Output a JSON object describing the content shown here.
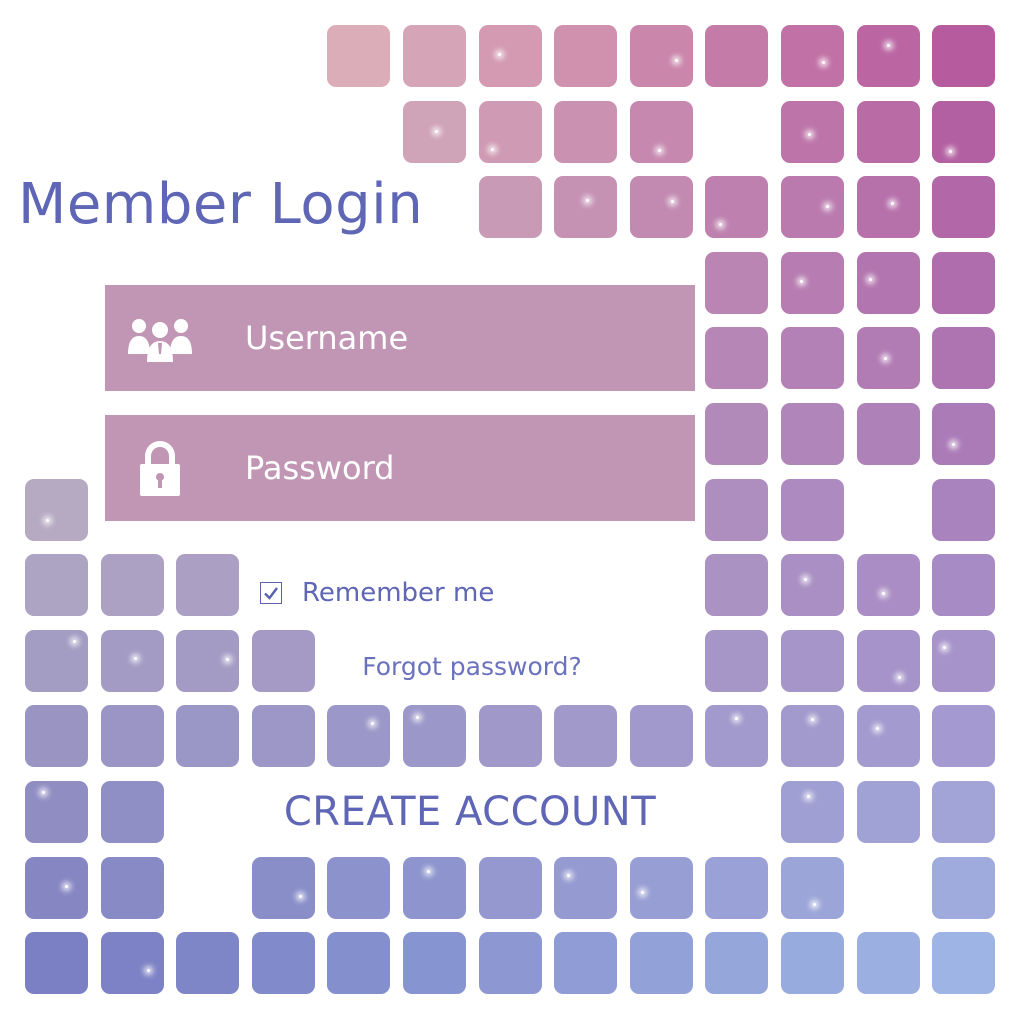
{
  "title": "Member Login",
  "username": {
    "placeholder": "Username",
    "icon": "users-icon"
  },
  "password": {
    "placeholder": "Password",
    "icon": "lock-icon"
  },
  "remember": {
    "label": "Remember me",
    "checked": true
  },
  "forgot_label": "Forgot password?",
  "create_label": "CREATE ACCOUNT",
  "colors": {
    "title": "#5e66b5",
    "field_bg": "#c195b4",
    "mosaic_top_left": "#e8c0aa",
    "mosaic_top_right": "#a83c8c",
    "mosaic_bottom_left": "#6266b8",
    "mosaic_bottom_right": "#9ab8e8"
  }
}
